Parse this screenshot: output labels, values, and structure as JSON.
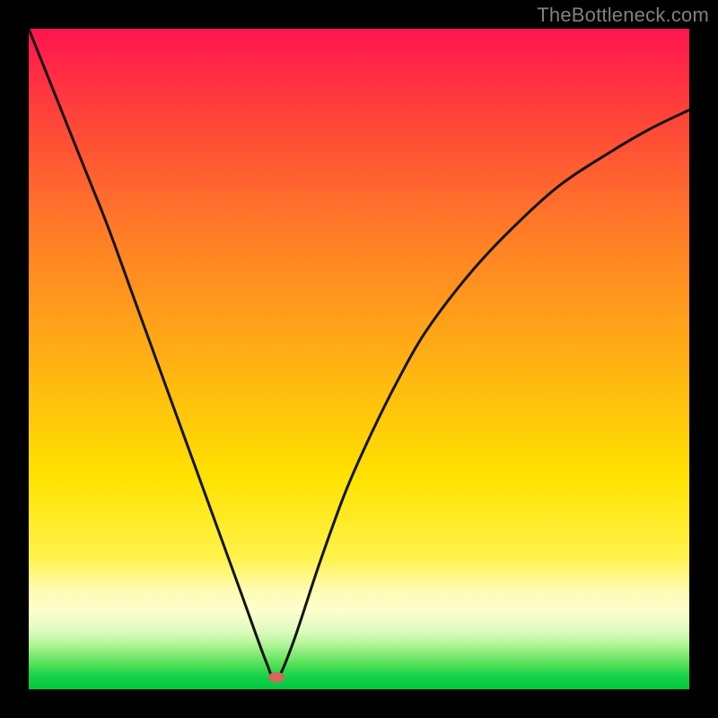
{
  "watermark": "TheBottleneck.com",
  "marker": {
    "cx_frac": 0.375,
    "cy_frac": 0.982,
    "rx": 9,
    "ry": 6,
    "fill": "#d06a5a"
  },
  "curve_stroke": "#141414",
  "curve_width": 3,
  "chart_data": {
    "type": "line",
    "title": "",
    "xlabel": "",
    "ylabel": "",
    "xlim": [
      0,
      1
    ],
    "ylim": [
      0,
      1
    ],
    "legend": false,
    "grid": false,
    "notes": "V-shaped bottleneck curve reaching minimum near x≈0.375. Background is vertical rainbow gradient (red top → green bottom). No axis ticks or numeric labels are rendered on screen. Values below are y as fraction-from-top (1=top=red, 0=bottom=green), read from plotted curve at sampled x fractions.",
    "series": [
      {
        "name": "bottleneck-curve",
        "x": [
          0.0,
          0.04,
          0.08,
          0.12,
          0.16,
          0.2,
          0.24,
          0.28,
          0.32,
          0.36,
          0.375,
          0.4,
          0.44,
          0.48,
          0.52,
          0.56,
          0.6,
          0.66,
          0.72,
          0.8,
          0.88,
          0.94,
          1.0
        ],
        "y": [
          1.0,
          0.9,
          0.8,
          0.7,
          0.59,
          0.48,
          0.37,
          0.26,
          0.15,
          0.04,
          0.015,
          0.07,
          0.19,
          0.3,
          0.39,
          0.47,
          0.54,
          0.62,
          0.686,
          0.76,
          0.813,
          0.848,
          0.877
        ]
      }
    ],
    "marker_point": {
      "x": 0.375,
      "y": 0.018
    },
    "background_gradient_stops": [
      {
        "pos": 0.0,
        "color": "#ff1450"
      },
      {
        "pos": 0.12,
        "color": "#ff3f3b"
      },
      {
        "pos": 0.3,
        "color": "#ff7a28"
      },
      {
        "pos": 0.5,
        "color": "#ffb014"
      },
      {
        "pos": 0.68,
        "color": "#ffe200"
      },
      {
        "pos": 0.8,
        "color": "#fff24a"
      },
      {
        "pos": 0.85,
        "color": "#fffbb3"
      },
      {
        "pos": 0.88,
        "color": "#fefecc"
      },
      {
        "pos": 0.91,
        "color": "#e0fbc2"
      },
      {
        "pos": 0.93,
        "color": "#b6f69a"
      },
      {
        "pos": 0.96,
        "color": "#5be15a"
      },
      {
        "pos": 0.98,
        "color": "#16d249"
      },
      {
        "pos": 1.0,
        "color": "#00c93d"
      }
    ]
  }
}
